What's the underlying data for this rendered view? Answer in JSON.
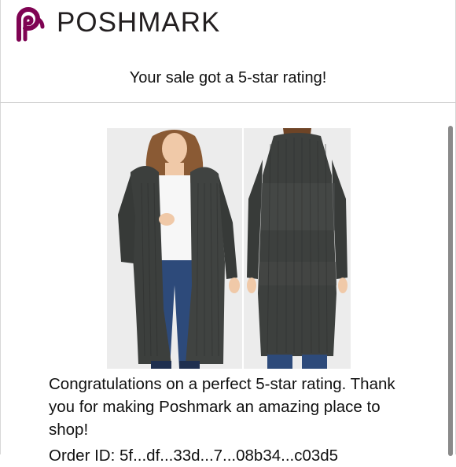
{
  "header": {
    "brand": "POSHMARK",
    "logo_icon": "poshmark-logo-icon",
    "brand_color": "#7f0353"
  },
  "email": {
    "subject_line": "Your sale got a 5-star rating!",
    "message": "Congratulations on a perfect 5-star rating. Thank you for making Poshmark an amazing place to shop!",
    "order_line_partial": "Order ID: 5f...df...33d...7...08b34...c03d5"
  },
  "product_images": [
    {
      "name": "product-photo-front"
    },
    {
      "name": "product-photo-back"
    }
  ]
}
